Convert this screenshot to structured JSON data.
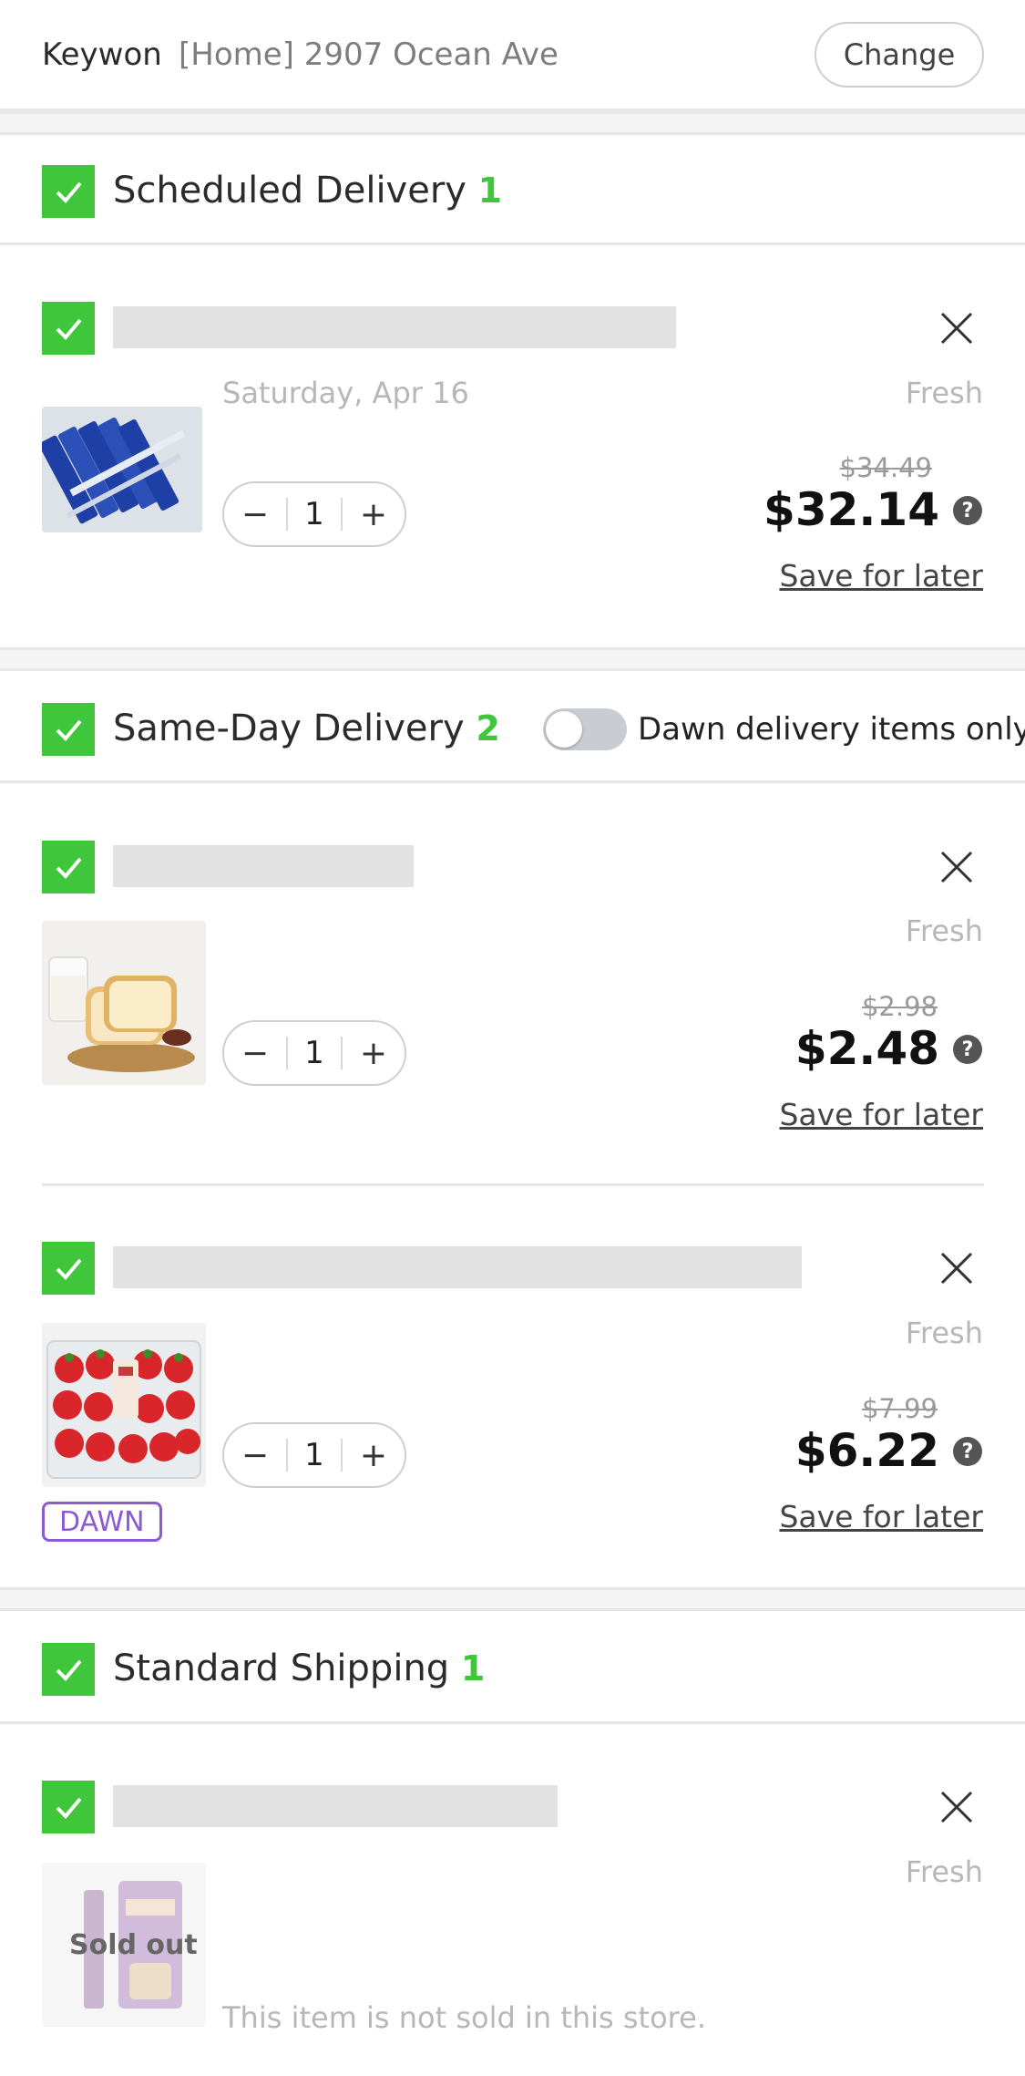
{
  "header": {
    "name": "Keywon",
    "address": "[Home] 2907 Ocean Ave",
    "change_label": "Change"
  },
  "sections": {
    "scheduled": {
      "title": "Scheduled Delivery",
      "count": "1"
    },
    "same_day": {
      "title": "Same-Day Delivery",
      "count": "2",
      "toggle_label": "Dawn delivery items only",
      "toggle_on": false
    },
    "standard": {
      "title": "Standard Shipping",
      "count": "1"
    }
  },
  "items": [
    {
      "date": "Saturday, Apr 16",
      "tag": "Fresh",
      "orig_price": "$34.49",
      "price": "$32.14",
      "qty": "1",
      "save_label": "Save for later",
      "image": "wrapped-snack-sticks"
    },
    {
      "tag": "Fresh",
      "orig_price": "$2.98",
      "price": "$2.48",
      "qty": "1",
      "save_label": "Save for later",
      "image": "bread-and-milk"
    },
    {
      "tag": "Fresh",
      "orig_price": "$7.99",
      "price": "$6.22",
      "qty": "1",
      "save_label": "Save for later",
      "badge": "DAWN",
      "image": "strawberries-pack"
    },
    {
      "tag": "Fresh",
      "status": "Sold out",
      "note": "This item is not sold in this store.",
      "image": "boxed-product"
    }
  ],
  "icons": {
    "checkbox": "check-icon",
    "remove": "close-icon",
    "info": "question-icon",
    "minus": "minus-icon",
    "plus": "plus-icon"
  },
  "colors": {
    "accent_green": "#3fc63a",
    "dawn_purple": "#8b5bd6"
  }
}
